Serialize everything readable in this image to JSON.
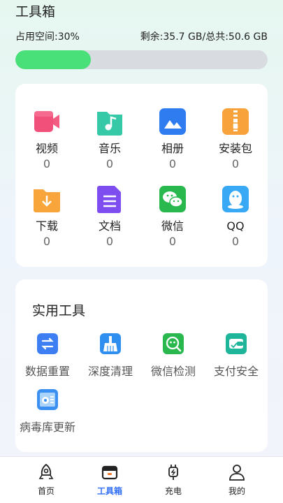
{
  "header": {
    "title": "工具箱"
  },
  "storage": {
    "used_label": "占用空间:30%",
    "used_fraction": 0.3,
    "summary": "剩余:35.7 GB/总共:50.6 GB",
    "bar_color": "#49e07a"
  },
  "files": {
    "items": [
      {
        "label": "视频",
        "count": "0",
        "icon": "video-icon"
      },
      {
        "label": "音乐",
        "count": "0",
        "icon": "music-file-icon"
      },
      {
        "label": "相册",
        "count": "0",
        "icon": "photo-album-icon"
      },
      {
        "label": "安装包",
        "count": "0",
        "icon": "package-icon"
      },
      {
        "label": "下载",
        "count": "0",
        "icon": "download-folder-icon"
      },
      {
        "label": "文档",
        "count": "0",
        "icon": "document-icon"
      },
      {
        "label": "微信",
        "count": "0",
        "icon": "wechat-icon"
      },
      {
        "label": "QQ",
        "count": "0",
        "icon": "qq-icon"
      }
    ]
  },
  "tools": {
    "title": "实用工具",
    "items": [
      {
        "label": "数据重置",
        "icon": "data-reset-icon"
      },
      {
        "label": "深度清理",
        "icon": "broom-icon"
      },
      {
        "label": "微信检测",
        "icon": "wechat-scan-icon"
      },
      {
        "label": "支付安全",
        "icon": "payment-shield-icon"
      },
      {
        "label": "病毒库更新",
        "icon": "virus-db-update-icon"
      }
    ]
  },
  "nav": {
    "items": [
      {
        "label": "首页",
        "icon": "rocket-icon",
        "active": false
      },
      {
        "label": "工具箱",
        "icon": "toolbox-icon",
        "active": true
      },
      {
        "label": "充电",
        "icon": "charger-icon",
        "active": false
      },
      {
        "label": "我的",
        "icon": "user-icon",
        "active": false
      }
    ],
    "active_color": "#2f6df6"
  }
}
